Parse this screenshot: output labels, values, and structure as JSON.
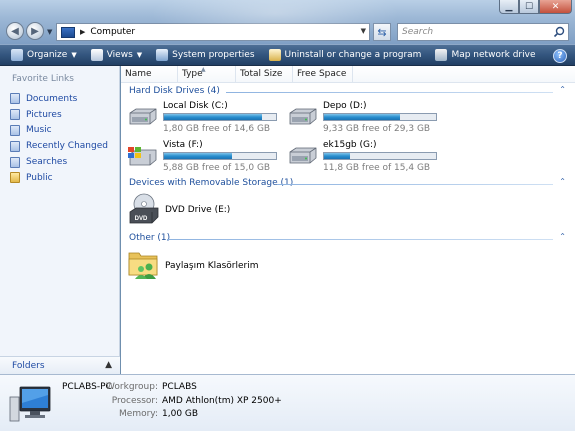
{
  "window": {
    "minimize_icon": "minimize-icon",
    "maximize_icon": "maximize-icon",
    "close_icon": "close-icon"
  },
  "address": {
    "path": "Computer",
    "search_placeholder": "Search"
  },
  "toolbar": {
    "organize": "Organize",
    "views": "Views",
    "system_properties": "System properties",
    "uninstall": "Uninstall or change a program",
    "map_drive": "Map network drive",
    "help": "?"
  },
  "navpane": {
    "title": "Favorite Links",
    "links": [
      {
        "label": "Documents",
        "icon": "documents-icon"
      },
      {
        "label": "Pictures",
        "icon": "pictures-icon"
      },
      {
        "label": "Music",
        "icon": "music-icon"
      },
      {
        "label": "Recently Changed",
        "icon": "recently-changed-icon"
      },
      {
        "label": "Searches",
        "icon": "searches-icon"
      },
      {
        "label": "Public",
        "icon": "public-folder-icon"
      }
    ],
    "folders_label": "Folders"
  },
  "columns": {
    "name": "Name",
    "type": "Type",
    "total_size": "Total Size",
    "free_space": "Free Space"
  },
  "groups": {
    "hard_drives": "Hard Disk Drives (4)",
    "removable": "Devices with Removable Storage (1)",
    "other": "Other (1)"
  },
  "drives": [
    {
      "name": "Local Disk (C:)",
      "free_text": "1,80 GB free of 14,6 GB",
      "used_fraction": 0.877,
      "icon": "hard-drive-icon"
    },
    {
      "name": "Depo (D:)",
      "free_text": "9,33 GB free of 29,3 GB",
      "used_fraction": 0.682,
      "icon": "hard-drive-icon"
    },
    {
      "name": "Vista (F:)",
      "free_text": "5,88 GB free of 15,0 GB",
      "used_fraction": 0.608,
      "icon": "windows-drive-icon"
    },
    {
      "name": "ek15gb (G:)",
      "free_text": "11,8 GB free of 15,4 GB",
      "used_fraction": 0.234,
      "icon": "hard-drive-icon"
    }
  ],
  "removable": {
    "name": "DVD Drive (E:)",
    "icon": "dvd-drive-icon",
    "icon_label": "DVD"
  },
  "other": {
    "name": "Paylaşım Klasörlerim",
    "icon": "shared-folder-icon"
  },
  "details": {
    "computer_name": "PCLABS-PC",
    "workgroup_label": "Workgroup:",
    "workgroup": "PCLABS",
    "processor_label": "Processor:",
    "processor": "AMD Athlon(tm) XP 2500+",
    "memory_label": "Memory:",
    "memory": "1,00 GB"
  }
}
